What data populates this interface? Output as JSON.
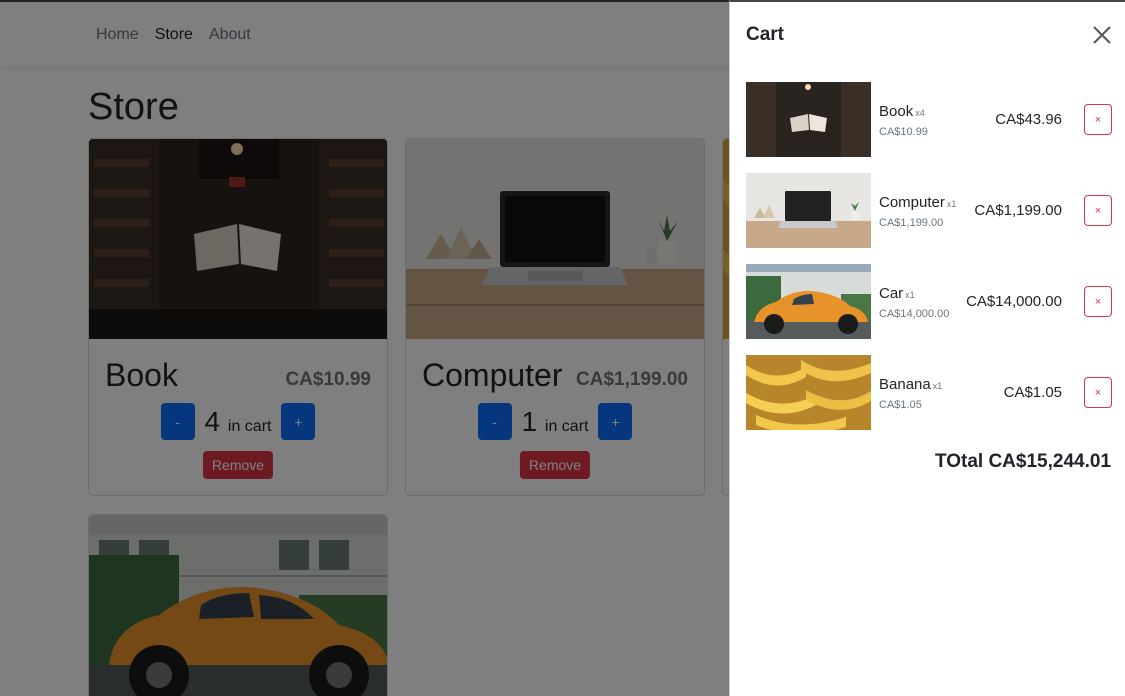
{
  "nav": {
    "items": [
      {
        "label": "Home"
      },
      {
        "label": "Store"
      },
      {
        "label": "About"
      }
    ]
  },
  "store": {
    "title": "Store"
  },
  "products": [
    {
      "name": "Book",
      "price": "CA$10.99",
      "qty": "4",
      "qty_suffix": "in cart",
      "minus": "-",
      "plus": "+",
      "remove": "Remove"
    },
    {
      "name": "Computer",
      "price": "CA$1,199.00",
      "qty": "1",
      "qty_suffix": "in cart",
      "minus": "-",
      "plus": "+",
      "remove": "Remove"
    }
  ],
  "cart": {
    "title": "Cart",
    "items": [
      {
        "name": "Book",
        "multiplier": "x4",
        "unit_price": "CA$10.99",
        "line_total": "CA$43.96",
        "remove": "×"
      },
      {
        "name": "Computer",
        "multiplier": "x1",
        "unit_price": "CA$1,199.00",
        "line_total": "CA$1,199.00",
        "remove": "×"
      },
      {
        "name": "Car",
        "multiplier": "x1",
        "unit_price": "CA$14,000.00",
        "line_total": "CA$14,000.00",
        "remove": "×"
      },
      {
        "name": "Banana",
        "multiplier": "x1",
        "unit_price": "CA$1.05",
        "line_total": "CA$1.05",
        "remove": "×"
      }
    ],
    "total": "TOtal CA$15,244.01"
  },
  "colors": {
    "primary": "#0d6efd",
    "danger": "#dc3545",
    "muted": "#6c757d",
    "car_orange": "#e8922a"
  }
}
